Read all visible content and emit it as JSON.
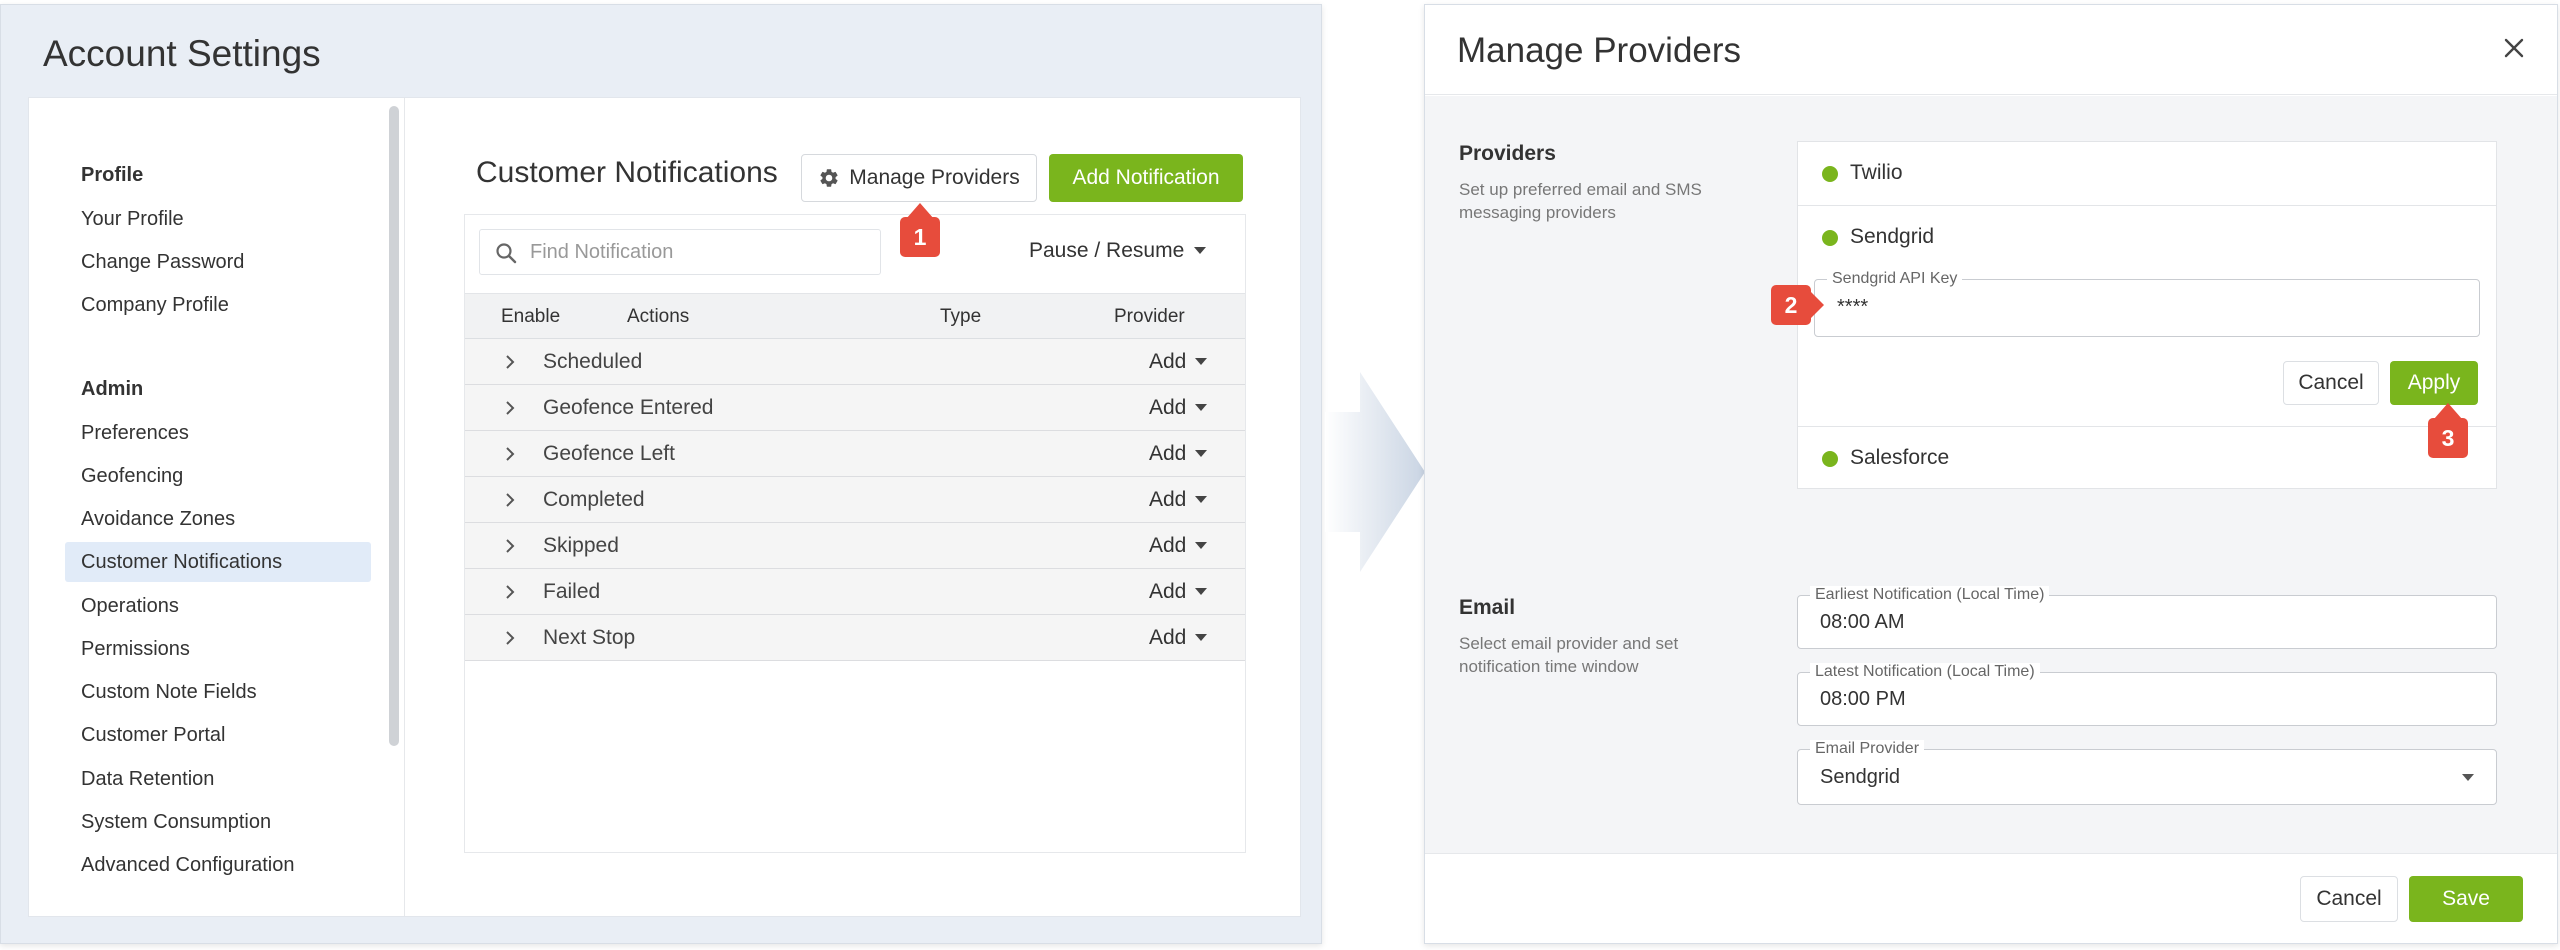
{
  "account_settings": {
    "title": "Account Settings",
    "sidebar": {
      "profile_heading": "Profile",
      "profile_items": [
        "Your Profile",
        "Change Password",
        "Company Profile"
      ],
      "admin_heading": "Admin",
      "admin_items": [
        "Preferences",
        "Geofencing",
        "Avoidance Zones",
        "Customer Notifications",
        "Operations",
        "Permissions",
        "Custom Note Fields",
        "Customer Portal",
        "Data Retention",
        "System Consumption",
        "Advanced Configuration"
      ],
      "active_item": "Customer Notifications"
    },
    "main": {
      "title": "Customer Notifications",
      "manage_providers_label": "Manage Providers",
      "add_notification_label": "Add Notification",
      "search_placeholder": "Find Notification",
      "pause_resume_label": "Pause / Resume",
      "columns": [
        "Enable",
        "Actions",
        "Type",
        "Provider"
      ],
      "rows": [
        {
          "label": "Scheduled",
          "action": "Add"
        },
        {
          "label": "Geofence Entered",
          "action": "Add"
        },
        {
          "label": "Geofence Left",
          "action": "Add"
        },
        {
          "label": "Completed",
          "action": "Add"
        },
        {
          "label": "Skipped",
          "action": "Add"
        },
        {
          "label": "Failed",
          "action": "Add"
        },
        {
          "label": "Next Stop",
          "action": "Add"
        }
      ]
    }
  },
  "callouts": [
    "1",
    "2",
    "3"
  ],
  "manage_providers": {
    "title": "Manage Providers",
    "providers_section": {
      "title": "Providers",
      "description": "Set up preferred email and SMS messaging providers",
      "providers": [
        "Twilio",
        "Sendgrid",
        "Salesforce"
      ],
      "api_key_label": "Sendgrid API Key",
      "api_key_value": "****",
      "cancel_label": "Cancel",
      "apply_label": "Apply"
    },
    "email_section": {
      "title": "Email",
      "description": "Select email provider and set notification time window",
      "earliest_label": "Earliest Notification (Local Time)",
      "earliest_value": "08:00 AM",
      "latest_label": "Latest Notification (Local Time)",
      "latest_value": "08:00 PM",
      "provider_label": "Email Provider",
      "provider_value": "Sendgrid"
    },
    "footer": {
      "cancel_label": "Cancel",
      "save_label": "Save"
    }
  },
  "colors": {
    "accent_green": "#7ab51d",
    "callout_red": "#e74c3c",
    "active_item_bg": "#e1ebf8"
  },
  "icons": [
    "gear-icon",
    "search-icon",
    "chevron-right-icon",
    "caret-down-icon",
    "close-icon",
    "status-dot-icon",
    "arrow-right-icon"
  ]
}
